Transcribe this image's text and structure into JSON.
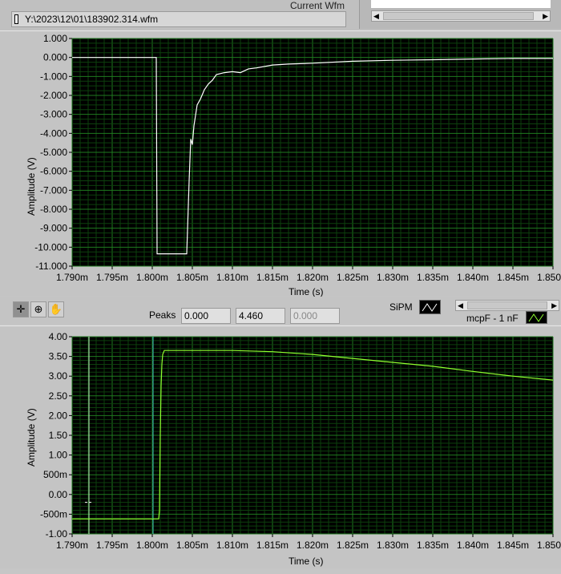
{
  "header": {
    "current_wfm_label": "Current Wfm",
    "file_path": "Y:\\2023\\12\\01\\183902.314.wfm"
  },
  "palette": {
    "window_bg": "#c4c4c4",
    "plot_bg": "#000000",
    "grid_major": "#1f7a1f",
    "grid_minor": "#0d400d",
    "trace_sipm": "#ffffff",
    "trace_mcpf": "#90ff30",
    "cursor_a": "#c8ffc8",
    "cursor_b": "#40c0c0"
  },
  "toolbar": {
    "icons": [
      "cursor-crosshair-icon",
      "zoom-icon",
      "pan-hand-icon"
    ]
  },
  "peaks": {
    "label": "Peaks",
    "values": [
      "0.000",
      "4.460",
      "0.000"
    ]
  },
  "legend": {
    "sipm": "SiPM",
    "mcpf": "mcpF - 1 nF"
  },
  "chart_data": [
    {
      "type": "line",
      "xlabel": "Time (s)",
      "ylabel": "Amplitude (V)",
      "xlim": [
        0.00179,
        0.00185
      ],
      "ylim": [
        -11,
        1
      ],
      "grid": true,
      "xticks": [
        "1.790m",
        "1.795m",
        "1.800m",
        "1.805m",
        "1.810m",
        "1.815m",
        "1.820m",
        "1.825m",
        "1.830m",
        "1.835m",
        "1.840m",
        "1.845m",
        "1.850m"
      ],
      "yticks": [
        "1.000",
        "0.000",
        "-1.000",
        "-2.000",
        "-3.000",
        "-4.000",
        "-5.000",
        "-6.000",
        "-7.000",
        "-8.000",
        "-9.000",
        "-10.000",
        "-11.000"
      ],
      "series": [
        {
          "legend": "SiPM",
          "color": "#ffffff",
          "x": [
            0.00179,
            0.0018005,
            0.0018006,
            0.0018043,
            0.0018046,
            0.0018048,
            0.001805,
            0.0018052,
            0.0018056,
            0.001806,
            0.0018065,
            0.001807,
            0.0018075,
            0.001808,
            0.001809,
            0.00181,
            0.001811,
            0.001812,
            0.001813,
            0.001815,
            0.001817,
            0.00182,
            0.001825,
            0.00183,
            0.001835,
            0.00184,
            0.001845,
            0.00185
          ],
          "y": [
            0,
            0,
            -10.35,
            -10.35,
            -6.5,
            -4.3,
            -4.6,
            -3.6,
            -2.5,
            -2.2,
            -1.7,
            -1.4,
            -1.2,
            -0.9,
            -0.8,
            -0.75,
            -0.8,
            -0.6,
            -0.55,
            -0.4,
            -0.35,
            -0.3,
            -0.2,
            -0.15,
            -0.12,
            -0.08,
            -0.05,
            -0.05
          ]
        }
      ]
    },
    {
      "type": "line",
      "xlabel": "Time (s)",
      "ylabel": "Amplitude (V)",
      "xlim": [
        0.00179,
        0.00185
      ],
      "ylim": [
        -1,
        4
      ],
      "grid": true,
      "xticks": [
        "1.790m",
        "1.795m",
        "1.800m",
        "1.805m",
        "1.810m",
        "1.815m",
        "1.820m",
        "1.825m",
        "1.830m",
        "1.835m",
        "1.840m",
        "1.845m",
        "1.850m"
      ],
      "yticks": [
        "4.00",
        "3.50",
        "3.00",
        "2.50",
        "2.00",
        "1.50",
        "1.00",
        "500m",
        "0.00",
        "-500m",
        "-1.00"
      ],
      "cursors": [
        0.0017921,
        0.0018001
      ],
      "series": [
        {
          "legend": "mcpF - 1 nF",
          "color": "#90ff30",
          "x": [
            0.00179,
            0.0018008,
            0.0018009,
            0.001801,
            0.0018011,
            0.0018012,
            0.0018013,
            0.0018015,
            0.00181,
            0.001815,
            0.00182,
            0.001825,
            0.00183,
            0.001835,
            0.00184,
            0.001845,
            0.00185
          ],
          "y": [
            -0.62,
            -0.62,
            -0.4,
            1.5,
            2.75,
            3.3,
            3.55,
            3.65,
            3.65,
            3.62,
            3.55,
            3.45,
            3.35,
            3.25,
            3.12,
            3.0,
            2.9
          ]
        }
      ]
    }
  ]
}
